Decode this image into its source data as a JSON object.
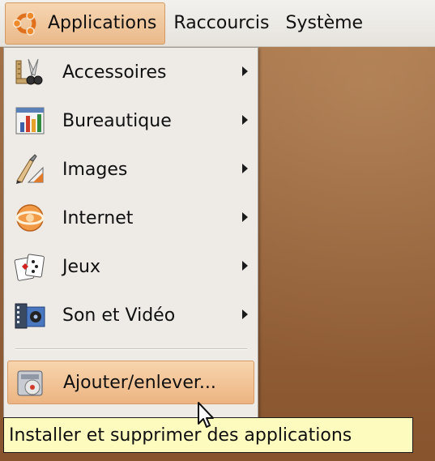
{
  "panel": {
    "menus": [
      {
        "label": "Applications"
      },
      {
        "label": "Raccourcis"
      },
      {
        "label": "Système"
      }
    ]
  },
  "menu": {
    "items": [
      {
        "label": "Accessoires",
        "icon": "accessories-icon",
        "has_submenu": true
      },
      {
        "label": "Bureautique",
        "icon": "office-icon",
        "has_submenu": true
      },
      {
        "label": "Images",
        "icon": "graphics-icon",
        "has_submenu": true
      },
      {
        "label": "Internet",
        "icon": "internet-icon",
        "has_submenu": true
      },
      {
        "label": "Jeux",
        "icon": "games-icon",
        "has_submenu": true
      },
      {
        "label": "Son et Vidéo",
        "icon": "multimedia-icon",
        "has_submenu": true
      }
    ],
    "add_remove": {
      "label": "Ajouter/enlever...",
      "icon": "package-installer-icon",
      "highlighted": true
    }
  },
  "tooltip": {
    "text": "Installer et supprimer des applications"
  },
  "colors": {
    "panel_bg": "#e6e3dd",
    "highlight": "#ecb482",
    "menu_bg": "#eeebe7",
    "tooltip_bg": "#fefbbf",
    "desktop": "#9a673f"
  }
}
